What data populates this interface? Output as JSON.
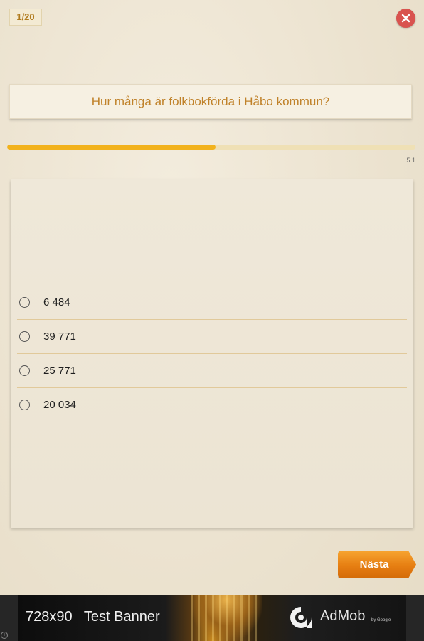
{
  "header": {
    "counter": "1/20",
    "close_icon": "close-icon"
  },
  "question": {
    "text": "Hur många är folkbokförda i Håbo kommun?"
  },
  "progress": {
    "fraction": 0.51,
    "timer_label": "5.1",
    "fill_color": "#f2b21c",
    "track_color": "#efe0b5"
  },
  "options": [
    {
      "label": "6 484"
    },
    {
      "label": "39 771"
    },
    {
      "label": "25 771"
    },
    {
      "label": "20 034"
    }
  ],
  "actions": {
    "next_label": "Nästa"
  },
  "ad": {
    "text": "728x90   Test Banner",
    "brand": "AdMob",
    "by": "by Google",
    "info": "i"
  },
  "colors": {
    "accent": "#c0822a",
    "close": "#d9534f",
    "next": "#e67e12"
  }
}
